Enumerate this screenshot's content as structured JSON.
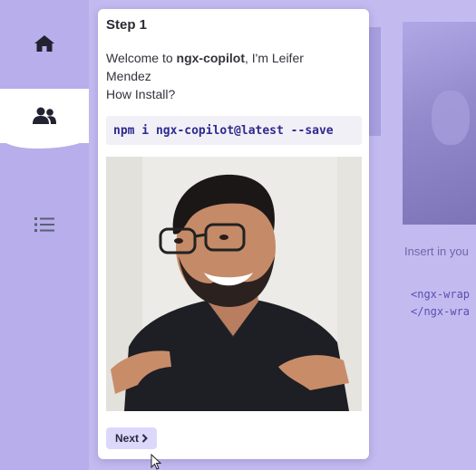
{
  "sidebar": {
    "items": [
      {
        "name": "home",
        "icon": "home-icon"
      },
      {
        "name": "users",
        "icon": "users-icon",
        "active": true
      },
      {
        "name": "list",
        "icon": "list-icon"
      }
    ]
  },
  "background": {
    "text": "Insert in you",
    "code_lines": "<ngx-wrap\n</ngx-wra"
  },
  "popup": {
    "title": "Step 1",
    "welcome_prefix": "Welcome to ",
    "welcome_brand": "ngx-copilot",
    "welcome_suffix": ", I'm Leifer Mendez",
    "how_install": "How Install?",
    "command": "npm i ngx-copilot@latest --save",
    "next_label": "Next",
    "next_icon": "chevron-right-icon"
  },
  "colors": {
    "sidebar_bg": "#b7aeeb",
    "content_bg": "#c3bbf0",
    "accent": "#2e2a8e",
    "button_bg": "#dcd8fb"
  }
}
